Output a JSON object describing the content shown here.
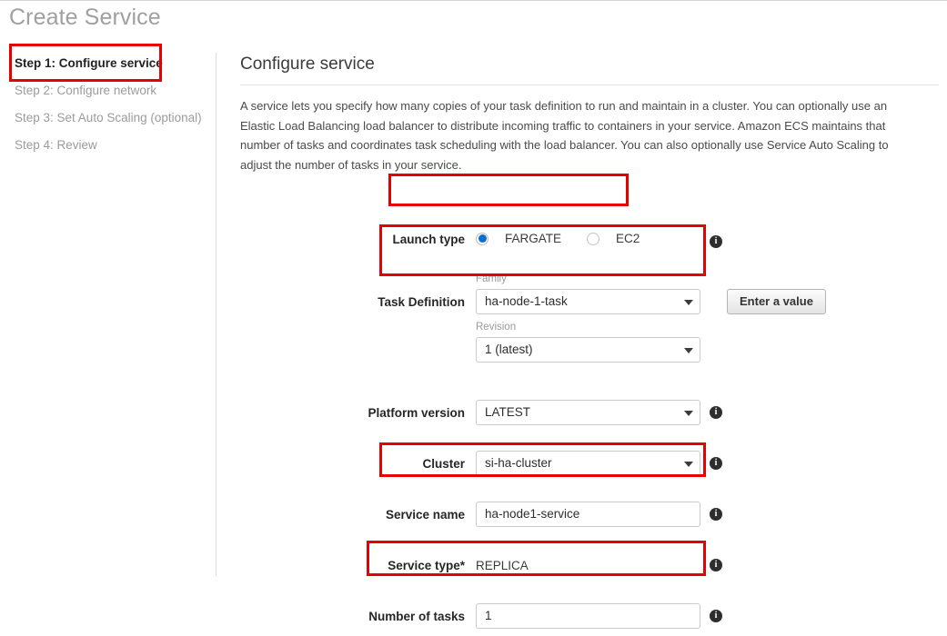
{
  "page": {
    "title": "Create Service"
  },
  "sidebar": {
    "steps": [
      {
        "label": "Step 1: Configure service",
        "state": "current"
      },
      {
        "label": "Step 2: Configure network",
        "state": "inactive"
      },
      {
        "label": "Step 3: Set Auto Scaling (optional)",
        "state": "inactive"
      },
      {
        "label": "Step 4: Review",
        "state": "inactive"
      }
    ]
  },
  "main": {
    "section_title": "Configure service",
    "description": "A service lets you specify how many copies of your task definition to run and maintain in a cluster. You can optionally use an Elastic Load Balancing load balancer to distribute incoming traffic to containers in your service. Amazon ECS maintains that number of tasks and coordinates task scheduling with the load balancer. You can also optionally use Service Auto Scaling to adjust the number of tasks in your service."
  },
  "form": {
    "launch_type": {
      "label": "Launch type",
      "options": [
        {
          "label": "FARGATE",
          "selected": true
        },
        {
          "label": "EC2",
          "selected": false
        }
      ]
    },
    "task_definition": {
      "label": "Task Definition",
      "family_sublabel": "Family",
      "family_value": "ha-node-1-task",
      "revision_sublabel": "Revision",
      "revision_value": "1 (latest)",
      "action_button": "Enter a value"
    },
    "platform_version": {
      "label": "Platform version",
      "value": "LATEST"
    },
    "cluster": {
      "label": "Cluster",
      "value": "si-ha-cluster"
    },
    "service_name": {
      "label": "Service name",
      "value": "ha-node1-service",
      "placeholder": ""
    },
    "service_type": {
      "label": "Service type*",
      "value": "REPLICA"
    },
    "number_of_tasks": {
      "label": "Number of tasks",
      "value": "1",
      "placeholder": ""
    }
  },
  "icons": {
    "info": "i",
    "info_name": "info-icon",
    "caret": "chevron-down-icon"
  },
  "annotations": {
    "color": "#e60000",
    "boxes": [
      "step-1-highlight",
      "launch-type-highlight",
      "task-definition-highlight",
      "service-name-highlight",
      "number-of-tasks-highlight"
    ]
  }
}
